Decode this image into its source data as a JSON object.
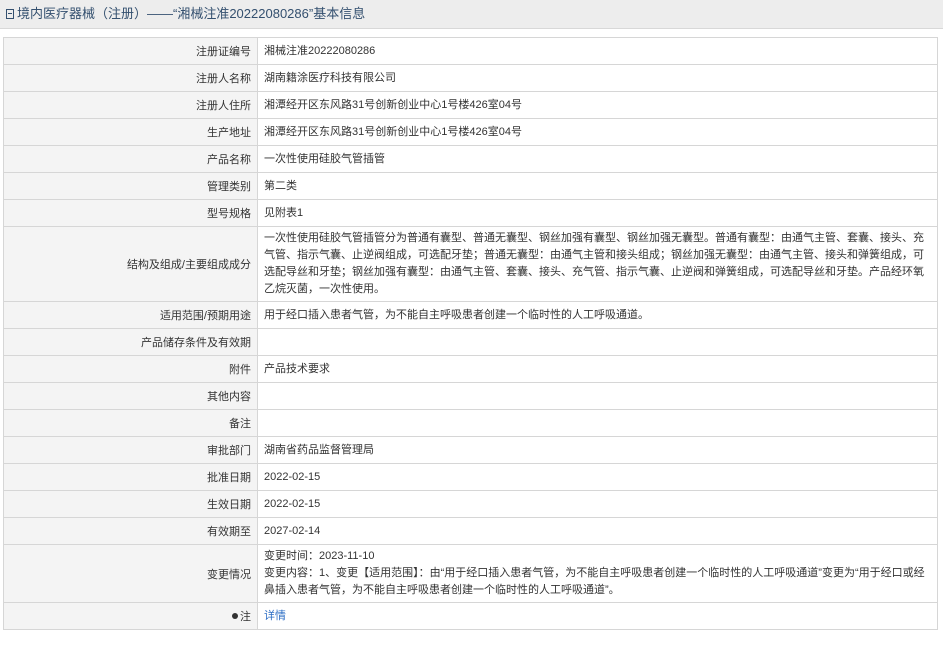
{
  "header": {
    "title": "境内医疗器械（注册）——“湘械注准20222080286”基本信息"
  },
  "rows": [
    {
      "label": "注册证编号",
      "value": "湘械注准20222080286"
    },
    {
      "label": "注册人名称",
      "value": "湖南籍涂医疗科技有限公司"
    },
    {
      "label": "注册人住所",
      "value": "湘潭经开区东风路31号创新创业中心1号楼426室04号"
    },
    {
      "label": "生产地址",
      "value": "湘潭经开区东风路31号创新创业中心1号楼426室04号"
    },
    {
      "label": "产品名称",
      "value": "一次性使用硅胶气管插管"
    },
    {
      "label": "管理类别",
      "value": "第二类"
    },
    {
      "label": "型号规格",
      "value": "见附表1"
    },
    {
      "label": "结构及组成/主要组成成分",
      "value": "一次性使用硅胶气管插管分为普通有囊型、普通无囊型、钢丝加强有囊型、钢丝加强无囊型。普通有囊型：由通气主管、套囊、接头、充气管、指示气囊、止逆阀组成，可选配牙垫；普通无囊型：由通气主管和接头组成；钢丝加强无囊型：由通气主管、接头和弹簧组成，可选配导丝和牙垫；钢丝加强有囊型：由通气主管、套囊、接头、充气管、指示气囊、止逆阀和弹簧组成，可选配导丝和牙垫。产品经环氧乙烷灭菌，一次性使用。"
    },
    {
      "label": "适用范围/预期用途",
      "value": "用于经口插入患者气管，为不能自主呼吸患者创建一个临时性的人工呼吸通道。"
    },
    {
      "label": "产品储存条件及有效期",
      "value": ""
    },
    {
      "label": "附件",
      "value": "产品技术要求"
    },
    {
      "label": "其他内容",
      "value": ""
    },
    {
      "label": "备注",
      "value": ""
    },
    {
      "label": "审批部门",
      "value": "湖南省药品监督管理局"
    },
    {
      "label": "批准日期",
      "value": "2022-02-15"
    },
    {
      "label": "生效日期",
      "value": "2022-02-15"
    },
    {
      "label": "有效期至",
      "value": "2027-02-14"
    }
  ],
  "change": {
    "label": "变更情况",
    "time": "变更时间：2023-11-10",
    "content": "变更内容：1、变更【适用范围】：由“用于经口插入患者气管，为不能自主呼吸患者创建一个临时性的人工呼吸通道”变更为“用于经口或经鼻插入患者气管，为不能自主呼吸患者创建一个临时性的人工呼吸通道”。"
  },
  "note": {
    "label": "注",
    "icon": "pin-icon",
    "link_text": "详情"
  }
}
